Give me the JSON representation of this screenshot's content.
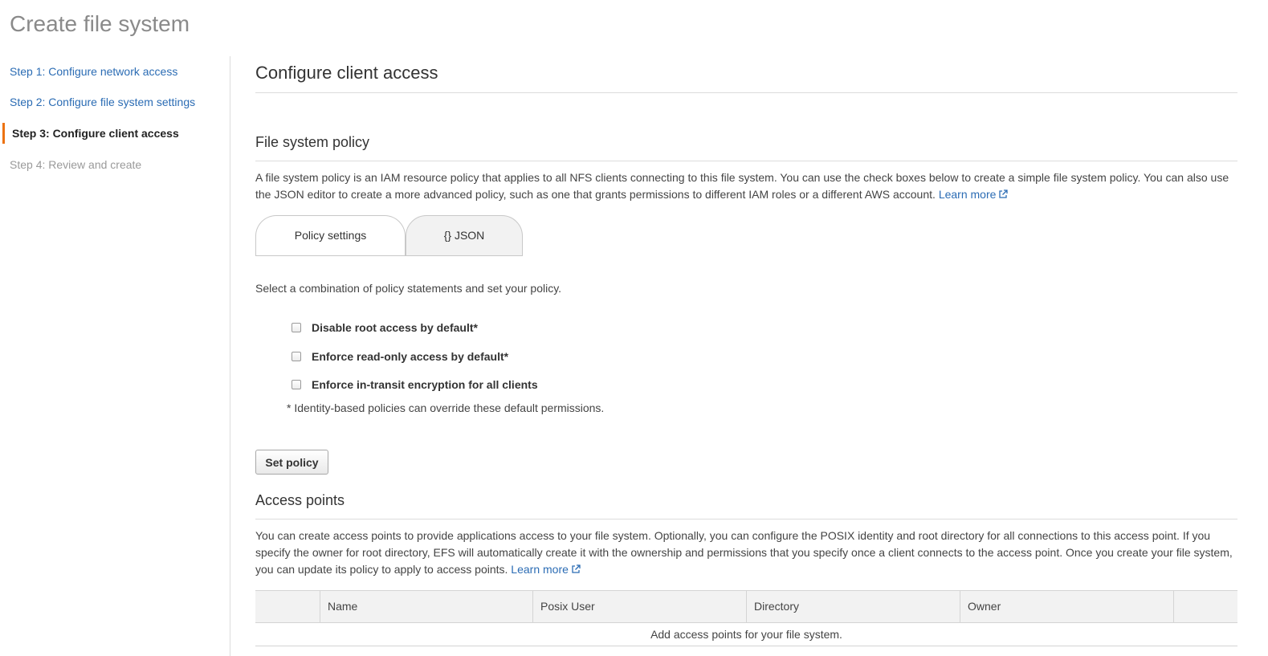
{
  "page": {
    "title": "Create file system"
  },
  "sidebar": {
    "steps": [
      {
        "label": "Step 1: Configure network access",
        "state": "link"
      },
      {
        "label": "Step 2: Configure file system settings",
        "state": "link"
      },
      {
        "label": "Step 3: Configure client access",
        "state": "active"
      },
      {
        "label": "Step 4: Review and create",
        "state": "disabled"
      }
    ]
  },
  "main": {
    "title": "Configure client access",
    "policy": {
      "title": "File system policy",
      "description": "A file system policy is an IAM resource policy that applies to all NFS clients connecting to this file system. You can use the check boxes below to create a simple file system policy. You can also use the JSON editor to create a more advanced policy, such as one that grants permissions to different IAM roles or a different AWS account.",
      "learn_more": "Learn more",
      "tabs": [
        {
          "label": "Policy settings",
          "active": true
        },
        {
          "label": "{} JSON",
          "active": false
        }
      ],
      "instructions": "Select a combination of policy statements and set your policy.",
      "options": [
        {
          "label": "Disable root access by default*",
          "checked": false
        },
        {
          "label": "Enforce read-only access by default*",
          "checked": false
        },
        {
          "label": "Enforce in-transit encryption for all clients",
          "checked": false
        }
      ],
      "note": "* Identity-based policies can override these default permissions.",
      "set_policy_label": "Set policy"
    },
    "access_points": {
      "title": "Access points",
      "description": "You can create access points to provide applications access to your file system. Optionally, you can configure the POSIX identity and root directory for all connections to this access point. If you specify the owner for root directory, EFS will automatically create it with the ownership and permissions that you specify once a client connects to the access point. Once you create your file system, you can update its policy to apply to access points.",
      "learn_more": "Learn more",
      "columns": [
        "",
        "Name",
        "Posix User",
        "Directory",
        "Owner",
        ""
      ],
      "empty_message": "Add access points for your file system."
    }
  },
  "colors": {
    "link": "#2b6cb4",
    "active_step_marker": "#ec7211",
    "table_header": "#f2f2f2"
  }
}
